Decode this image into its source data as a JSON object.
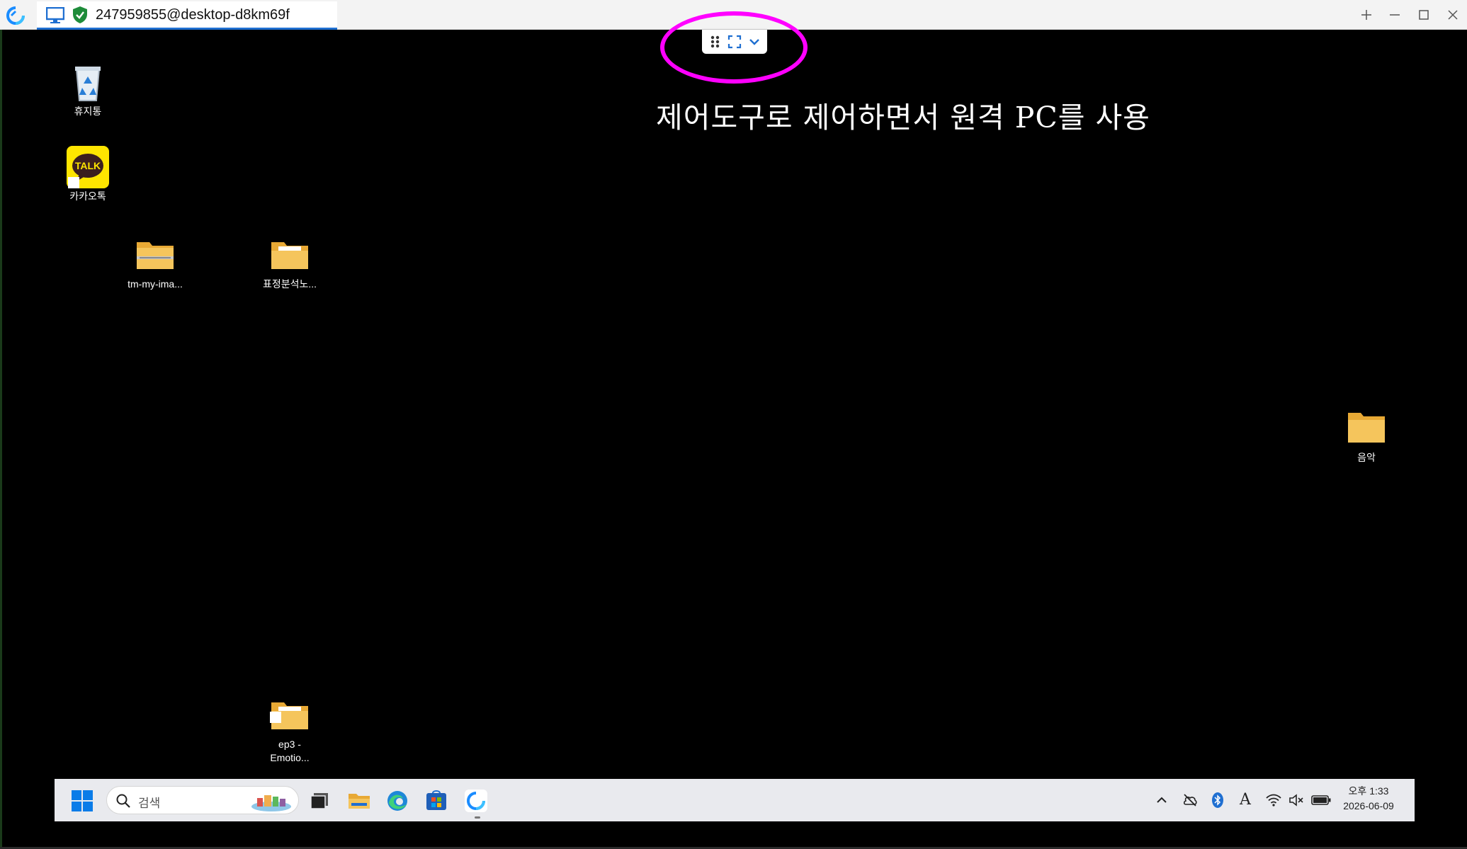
{
  "window": {
    "tab_title": "247959855@desktop-d8km69f"
  },
  "remote_toolbar": {
    "items": [
      "drag-handle-icon",
      "fullscreen-icon",
      "chevron-down-icon"
    ]
  },
  "annotation": {
    "text": "제어도구로 제어하면서 원격 PC를 사용",
    "highlight_color": "#ff00ff"
  },
  "desktop": {
    "icons": [
      {
        "label": "휴지통",
        "icon": "recycle-bin-icon"
      },
      {
        "label": "카카오톡",
        "icon": "kakaotalk-icon",
        "badge": "TALK"
      },
      {
        "label": "tm-my-ima...",
        "icon": "zip-folder-icon"
      },
      {
        "label": "표정분석노...",
        "icon": "folder-icon"
      },
      {
        "label": "음악",
        "icon": "music-folder-icon"
      },
      {
        "label": "ep3 -\nEmotio...",
        "icon": "folder-shortcut-icon"
      }
    ]
  },
  "taskbar": {
    "search_placeholder": "검색",
    "apps": [
      "start-icon",
      "task-view-icon",
      "file-explorer-icon",
      "edge-icon",
      "store-icon",
      "remote-app-icon"
    ],
    "tray": [
      "chevron-up-icon",
      "cloud-off-icon",
      "bluetooth-icon",
      "ime-icon",
      "wifi-icon",
      "volume-mute-icon",
      "battery-icon"
    ],
    "ime_label": "A",
    "clock_time": "오후 1:33",
    "clock_date": "2026-06-09"
  },
  "colors": {
    "accent": "#1f6fd1",
    "desktop_bg": "#000000",
    "folder": "#f2c14e"
  }
}
